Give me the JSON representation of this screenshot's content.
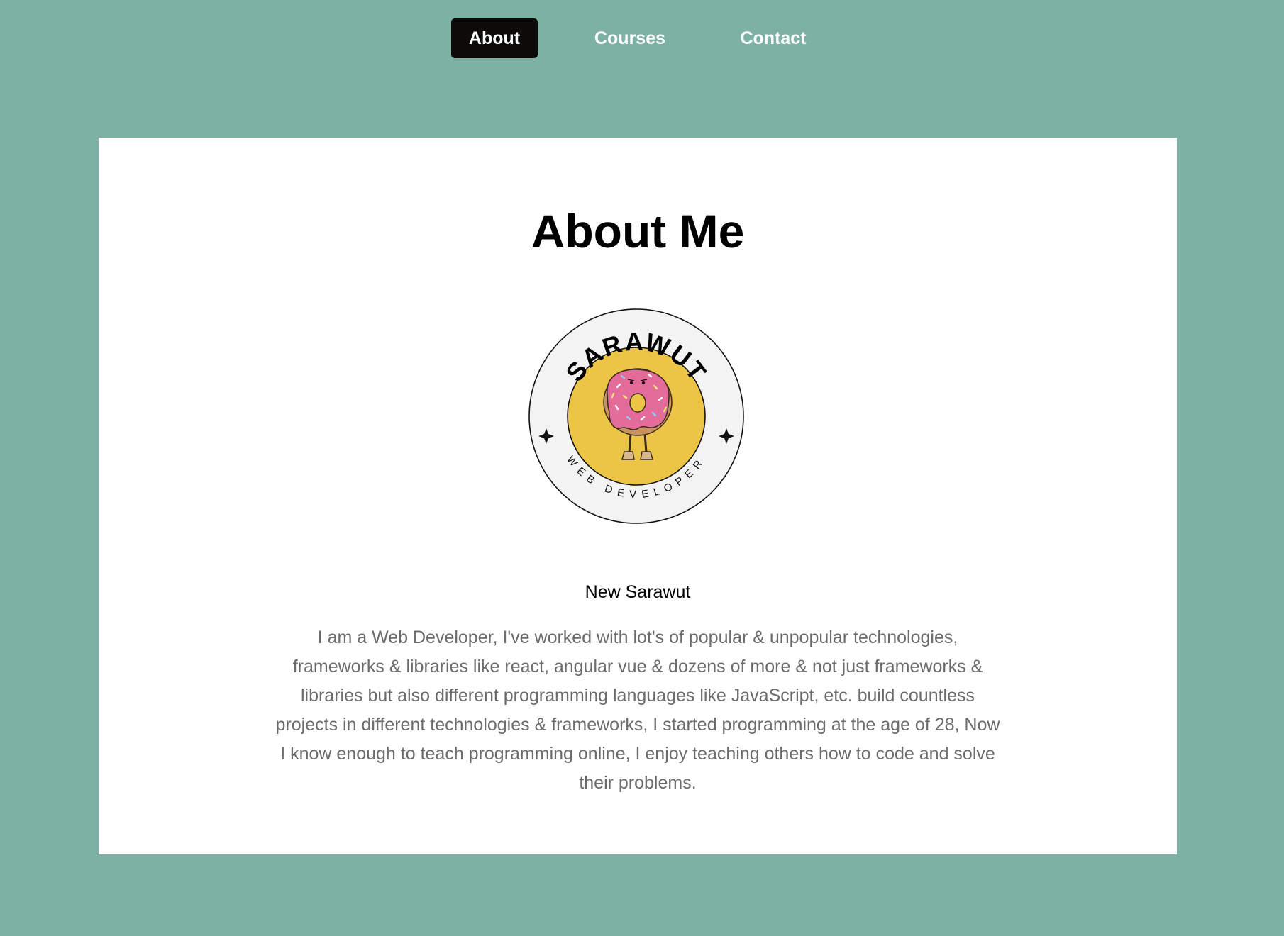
{
  "nav": {
    "items": [
      {
        "label": "About",
        "active": true
      },
      {
        "label": "Courses",
        "active": false
      },
      {
        "label": "Contact",
        "active": false
      }
    ]
  },
  "main": {
    "title": "About Me",
    "logo": {
      "top_text": "SARAWUT",
      "bottom_text": "WEB DEVELOPER",
      "icon": "donut-character-icon",
      "colors": {
        "ring": "#f3f3f3",
        "inner": "#ecc547",
        "donut_frosting": "#e46c9a"
      }
    },
    "name": "New Sarawut",
    "bio": "I am a Web Developer, I've worked with lot's of popular & unpopular technologies, frameworks & libraries like react, angular vue & dozens of more & not just frameworks & libraries but also different programming languages like JavaScript, etc. build countless projects in different technologies & frameworks, I started programming at the age of 28, Now I know enough to teach programming online, I enjoy teaching others how to code and solve their problems."
  },
  "colors": {
    "background": "#7cb1a3",
    "card": "#ffffff",
    "nav_active": "#0c0b09",
    "bio_text": "#6b6b6b"
  }
}
